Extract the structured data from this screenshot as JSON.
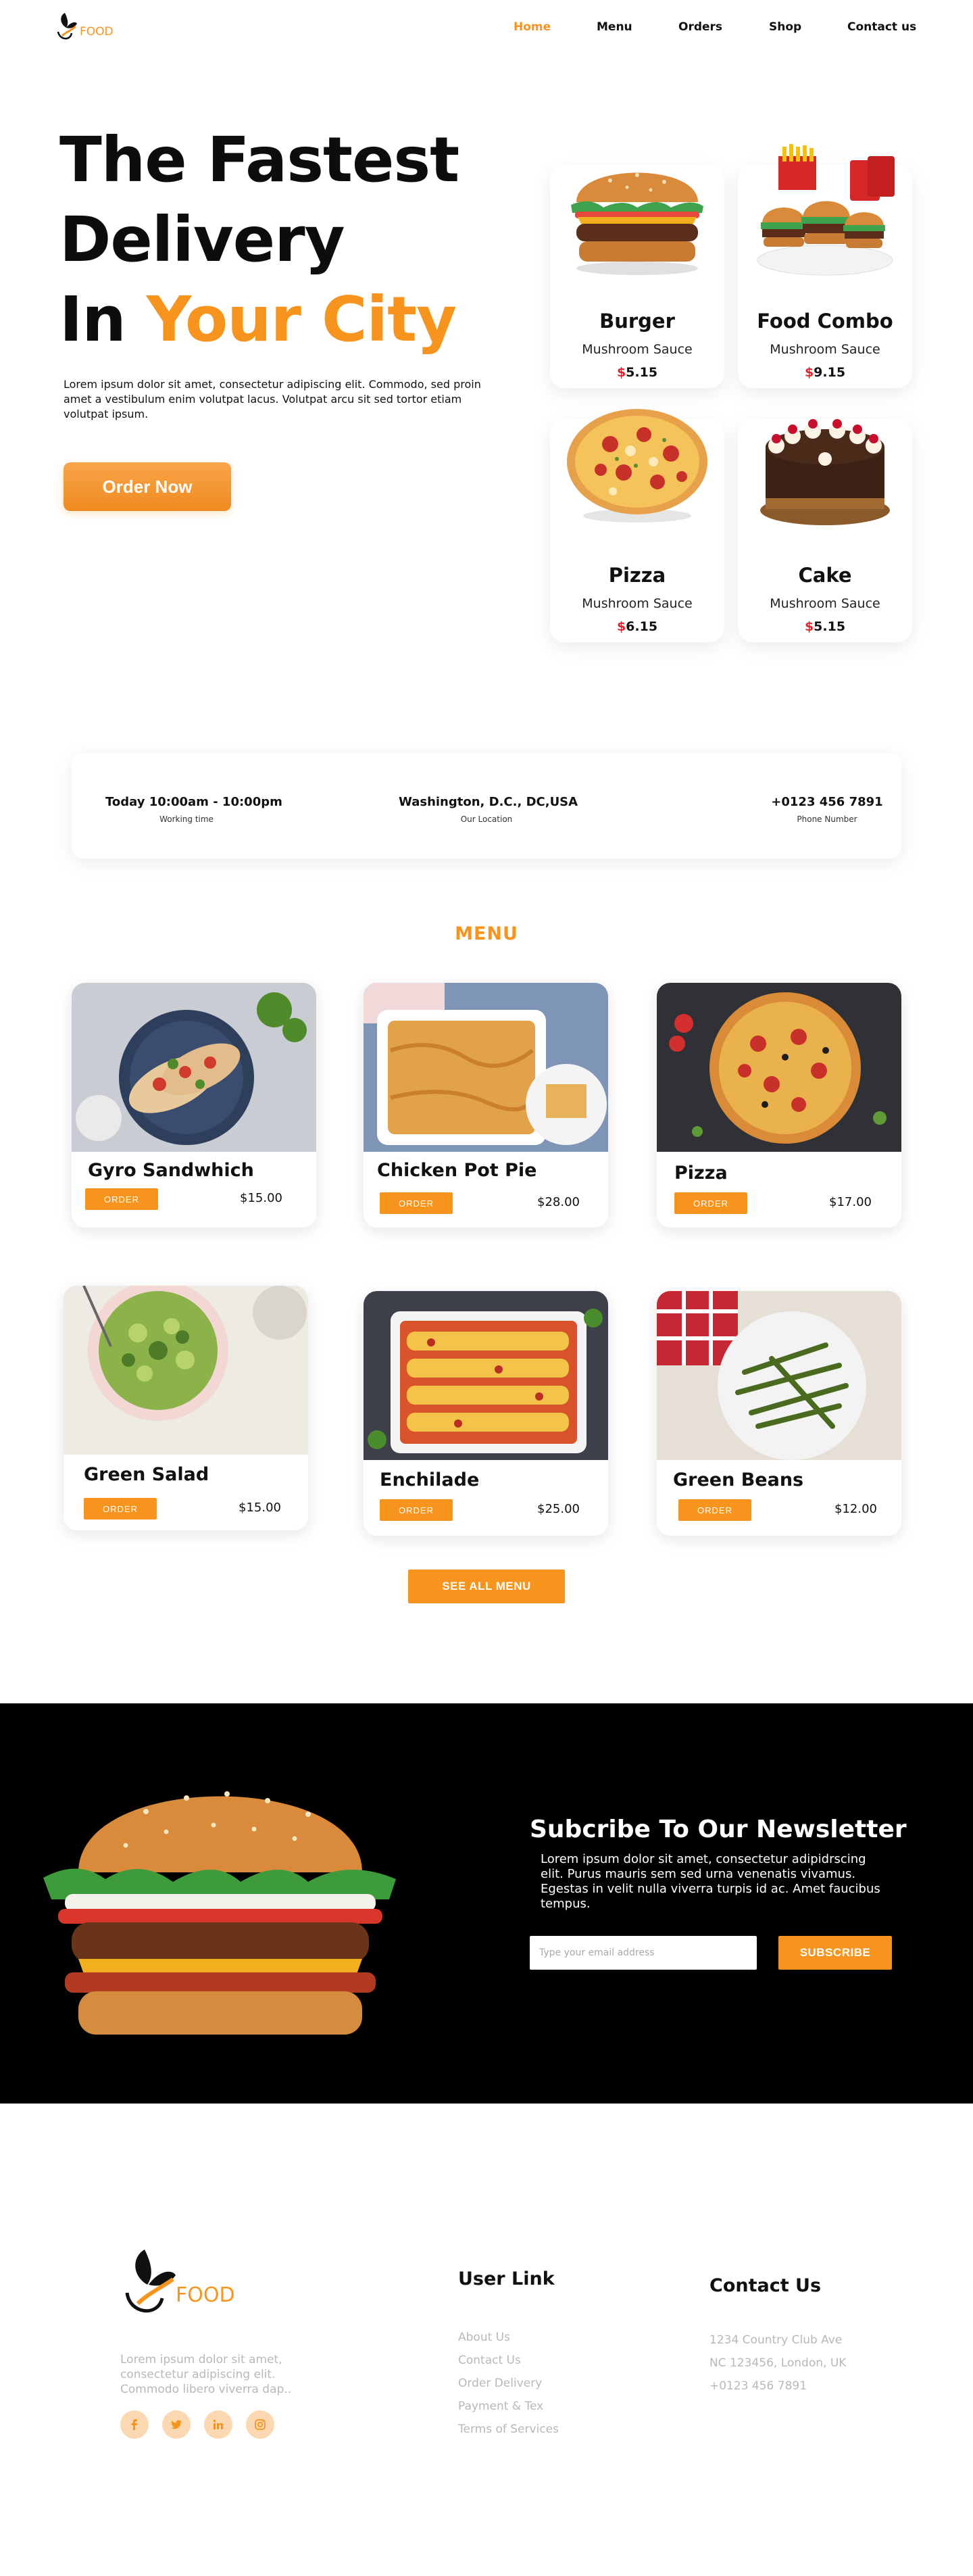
{
  "nav": {
    "logo_text": "FOOD",
    "items": [
      {
        "label": "Home",
        "active": true
      },
      {
        "label": "Menu",
        "active": false
      },
      {
        "label": "Orders",
        "active": false
      },
      {
        "label": "Shop",
        "active": false
      },
      {
        "label": "Contact us",
        "active": false
      }
    ]
  },
  "hero": {
    "title_line1": "The Fastest",
    "title_line2": "Delivery",
    "title_line3_plain": "In ",
    "title_line3_accent": "Your City",
    "paragraph": "Lorem ipsum dolor sit amet, consectetur adipiscing elit. Commodo, sed proin amet a vestibulum enim volutpat lacus. Volutpat arcu sit sed tortor etiam volutpat ipsum.",
    "cta_label": "Order Now",
    "cards": [
      {
        "name": "Burger",
        "sub": "Mushroom Sauce",
        "currency": "$",
        "price": "5.15",
        "icon": "burger-image"
      },
      {
        "name": "Food Combo",
        "sub": "Mushroom Sauce",
        "currency": "$",
        "price": "9.15",
        "icon": "food-combo-image"
      },
      {
        "name": "Pizza",
        "sub": "Mushroom Sauce",
        "currency": "$",
        "price": "6.15",
        "icon": "pizza-image"
      },
      {
        "name": "Cake",
        "sub": "Mushroom Sauce",
        "currency": "$",
        "price": "5.15",
        "icon": "cake-image"
      }
    ]
  },
  "info": {
    "hours_value": "Today 10:00am - 10:00pm",
    "hours_label": "Working time",
    "location_value": "Washington, D.C., DC,USA",
    "location_label": "Our Location",
    "phone_value": "+0123 456 7891",
    "phone_label": "Phone Number"
  },
  "menu": {
    "title": "MENU",
    "order_label": "ORDER",
    "items": [
      {
        "title": "Gyro Sandwhich",
        "price": "$15.00",
        "icon": "gyro-plate-image"
      },
      {
        "title": "Chicken Pot Pie",
        "price": "$28.00",
        "icon": "pot-pie-image"
      },
      {
        "title": "Pizza",
        "price": "$17.00",
        "icon": "pizza-image"
      },
      {
        "title": "Green Salad",
        "price": "$15.00",
        "icon": "salad-image"
      },
      {
        "title": "Enchilade",
        "price": "$25.00",
        "icon": "enchilada-image"
      },
      {
        "title": "Green Beans",
        "price": "$12.00",
        "icon": "green-beans-image"
      }
    ],
    "see_all_label": "SEE ALL MENU"
  },
  "newsletter": {
    "title": "Subcribe To Our Newsletter",
    "paragraph": "Lorem ipsum dolor sit amet, consectetur adipidrscing elit. Purus mauris sem sed urna venenatis vivamus. Egestas in velit nulla viverra turpis id ac. Amet faucibus tempus.",
    "email_placeholder": "Type your email address",
    "button_label": "SUBSCRIBE"
  },
  "footer": {
    "logo_text": "FOOD",
    "about": "Lorem ipsum dolor sit amet, consectetur adipiscing elit. Commodo libero viverra dap..",
    "socials": [
      "facebook-icon",
      "twitter-icon",
      "linkedin-icon",
      "instagram-icon"
    ],
    "user_link_title": "User Link",
    "user_links": [
      "About Us",
      "Contact Us",
      "Order Delivery",
      "Payment & Tex",
      "Terms of Services"
    ],
    "contact_title": "Contact Us",
    "contact_lines": [
      "1234 Country Club Ave",
      "NC 123456, London, UK",
      "+0123 456 7891"
    ]
  },
  "colors": {
    "accent": "#f7941d",
    "price_currency": "#e3242b",
    "newsletter_bg": "#000000"
  }
}
